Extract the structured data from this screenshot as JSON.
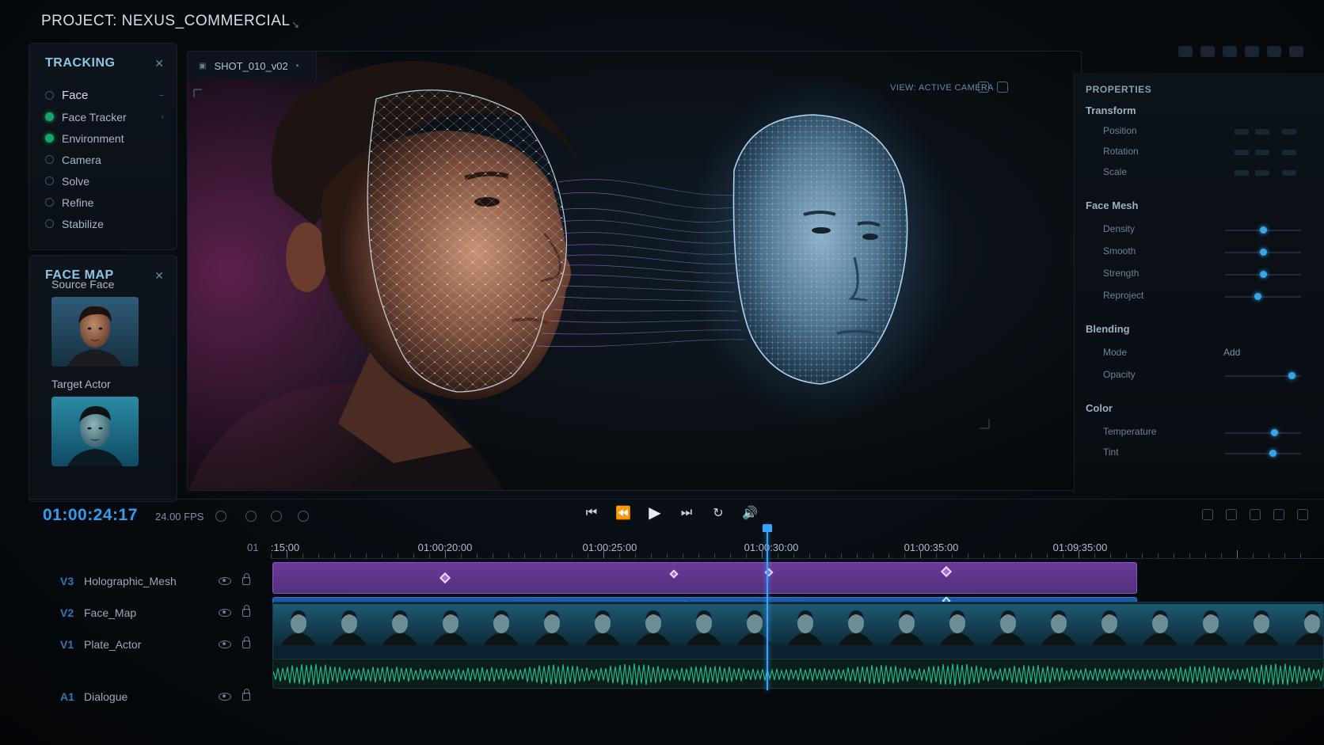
{
  "header": {
    "project_title": "PROJECT: NEXUS_COMMERCIAL"
  },
  "tracking": {
    "title": "TRACKING",
    "items": [
      {
        "label": "Face",
        "active": false
      },
      {
        "label": "Face Tracker",
        "active": true
      },
      {
        "label": "Environment",
        "active": true
      },
      {
        "label": "Camera",
        "active": false
      },
      {
        "label": "Solve",
        "active": false
      },
      {
        "label": "Refine",
        "active": false
      },
      {
        "label": "Stabilize",
        "active": false
      }
    ]
  },
  "face_map": {
    "title": "FACE MAP",
    "source_label": "Source Face",
    "target_label": "Target Actor"
  },
  "viewport": {
    "tab_label": "SHOT_010_v02",
    "view_label": "VIEW: ACTIVE CAMERA"
  },
  "properties": {
    "title": "PROPERTIES",
    "transform": {
      "title": "Transform",
      "rows": [
        "Position",
        "Rotation",
        "Scale"
      ]
    },
    "face_mesh": {
      "title": "Face Mesh",
      "rows": [
        "Density",
        "Smooth",
        "Strength",
        "Reproject"
      ]
    },
    "blending": {
      "title": "Blending",
      "mode_label": "Mode",
      "mode_value": "Add",
      "opacity_label": "Opacity"
    },
    "color": {
      "title": "Color",
      "rows": [
        "Temperature",
        "Tint"
      ]
    }
  },
  "transport": {
    "timecode": "01:00:24:17",
    "fps": "24.00 FPS"
  },
  "timeline": {
    "ruler_zero": "01",
    "ruler_labels": [
      ":15:00",
      "01:00:20:00",
      "01:00:25:00",
      "01:00:30:00",
      "01:00:35:00",
      "01:09:35:00"
    ],
    "tracks": [
      {
        "id": "V3",
        "name": "Holographic_Mesh"
      },
      {
        "id": "V2",
        "name": "Face_Map"
      },
      {
        "id": "V1",
        "name": "Plate_Actor"
      },
      {
        "id": "A1",
        "name": "Dialogue"
      }
    ]
  },
  "colors": {
    "accent": "#2f9df0",
    "mesh_clip": "#5f3590",
    "face_clip": "#1a55a0",
    "audio_wave": "#1fb98a",
    "active_dot": "#1aa36c"
  }
}
